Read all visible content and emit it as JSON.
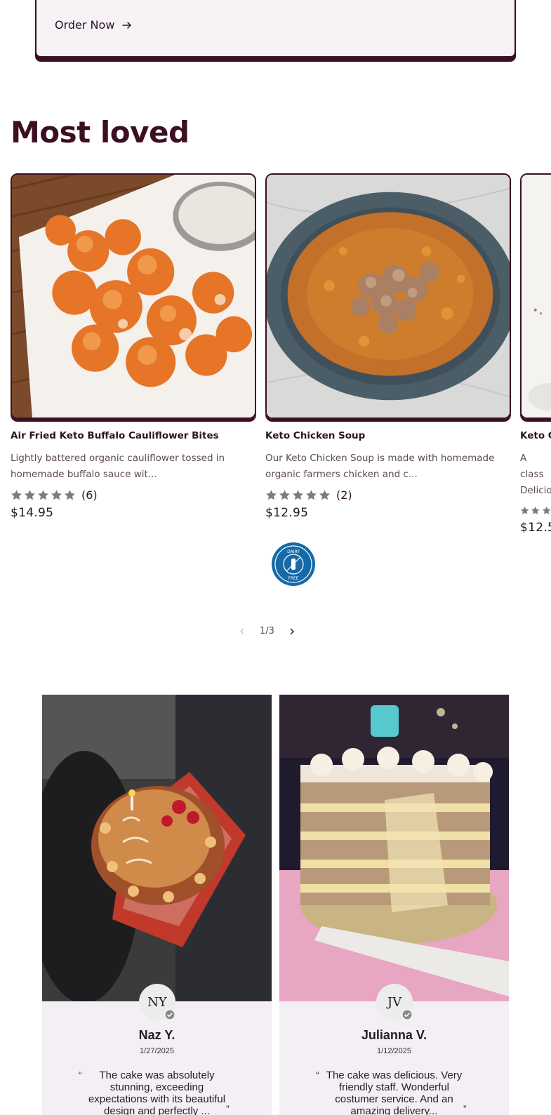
{
  "top_card": {
    "order_label": "Order Now"
  },
  "section": {
    "title": "Most loved"
  },
  "products": [
    {
      "name": "Air Fried Keto Buffalo Cauliflower Bites",
      "description": "Lightly battered organic cauliflower tossed in homemade buffalo sauce wit...",
      "rating": 5,
      "review_count": "(6)",
      "price": "$14.95"
    },
    {
      "name": "Keto Chicken Soup",
      "description": "Our Keto Chicken Soup is made with homemade organic farmers chicken and c...",
      "rating": 5,
      "review_count": "(2)",
      "price": "$12.95"
    },
    {
      "name": "Keto C",
      "description": "A class Delicio",
      "rating": 5,
      "review_count": "",
      "price": "$12.5"
    }
  ],
  "badge": {
    "line1": "DAIRY",
    "line2": "FREE"
  },
  "pager": {
    "text": "1/3"
  },
  "reviews": [
    {
      "initials": "NY",
      "name": "Naz Y.",
      "date": "1/27/2025",
      "text": "The cake was absolutely stunning, exceeding expectations with its beautiful design and perfectly ...",
      "open_quote": "“",
      "close_quote": "”"
    },
    {
      "initials": "JV",
      "name": "Julianna V.",
      "date": "1/12/2025",
      "text": "The cake was delicious. Very friendly staff. Wonderful costumer service. And an amazing delivery...",
      "open_quote": "“",
      "close_quote": "”"
    }
  ],
  "colors": {
    "brand_dark": "#3c0f22",
    "star_gray": "#7d7d7d",
    "badge_blue": "#156aa7",
    "review_bg": "#f3eff5"
  }
}
